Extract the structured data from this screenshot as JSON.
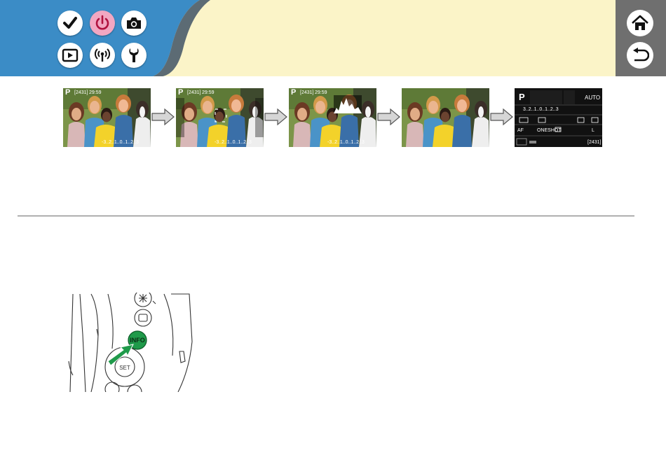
{
  "colors": {
    "header_blue": "#3b8cc6",
    "header_cream": "#fbf4c8",
    "sidebar_gray": "#6f6f6f",
    "active_button": "#f2a7c2",
    "info_button_green": "#1f9a4a"
  },
  "nav": {
    "buttons": [
      {
        "name": "check-icon",
        "label": "Basic Operations",
        "active": false
      },
      {
        "name": "power-icon",
        "label": "Basic Guide",
        "active": true
      },
      {
        "name": "camera-icon",
        "label": "Shooting",
        "active": false
      },
      {
        "name": "playback-icon",
        "label": "Playback",
        "active": false
      },
      {
        "name": "wireless-icon",
        "label": "Wireless Features",
        "active": false
      },
      {
        "name": "wrench-icon",
        "label": "Setting Menu",
        "active": false
      }
    ],
    "side": [
      {
        "name": "home-icon",
        "label": "Home"
      },
      {
        "name": "back-icon",
        "label": "Back"
      }
    ]
  },
  "screens": {
    "mode": "P",
    "shots_remaining": "[2431]",
    "time_remaining": "29:59",
    "exposure_scale": "-3..2..1..0..1..2..3",
    "panel": {
      "mode": "P",
      "iso": "AUTO",
      "scale": "3..2..1..0..1..2..3",
      "af": "AF",
      "drive": "ONESHOT",
      "quality": "L",
      "shots": "[2431]"
    }
  },
  "illustration": {
    "button_label": "INFO",
    "dial_label": "SET"
  }
}
